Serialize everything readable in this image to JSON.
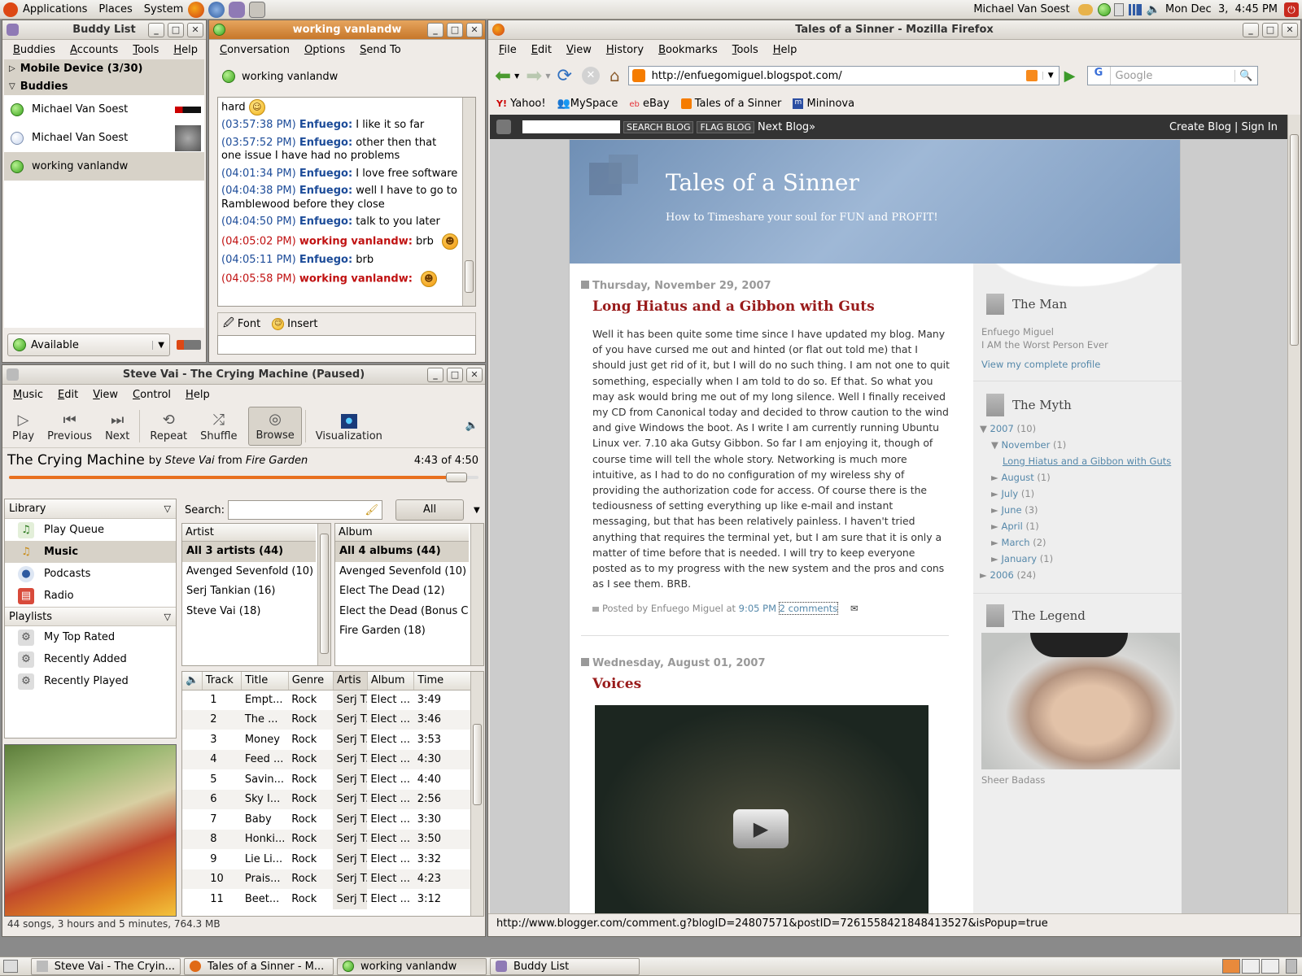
{
  "top_panel": {
    "menus": [
      "Applications",
      "Places",
      "System"
    ],
    "user": "Michael Van Soest",
    "clock": "Mon Dec  3,  4:45 PM"
  },
  "buddy_list": {
    "title": "Buddy List",
    "menu": [
      "Buddies",
      "Accounts",
      "Tools",
      "Help"
    ],
    "groups": [
      {
        "label": "Mobile Device (3/30)"
      },
      {
        "label": "Buddies"
      }
    ],
    "buddies": [
      {
        "name": "Michael Van Soest"
      },
      {
        "name": "Michael Van Soest"
      },
      {
        "name": "working vanlandw"
      }
    ],
    "status": "Available"
  },
  "conversation": {
    "title": "working vanlandw",
    "menu": [
      "Conversation",
      "Options",
      "Send To"
    ],
    "header_name": "working vanlandw",
    "first_line": "hard",
    "messages": [
      {
        "time": "(03:57:38 PM)",
        "who": "Enfuego:",
        "text": " I like it so far",
        "mine": false
      },
      {
        "time": "(03:57:52 PM)",
        "who": "Enfuego:",
        "text": " other then that one issue I have had no problems",
        "mine": false
      },
      {
        "time": "(04:01:34 PM)",
        "who": "Enfuego:",
        "text": " I love free software",
        "mine": false
      },
      {
        "time": "(04:04:38 PM)",
        "who": "Enfuego:",
        "text": " well I have to go to Ramblewood before they close",
        "mine": false
      },
      {
        "time": "(04:04:50 PM)",
        "who": "Enfuego:",
        "text": " talk to you later",
        "mine": false
      },
      {
        "time": "(04:05:02 PM)",
        "who": "working vanlandw:",
        "text": " brb",
        "mine": true
      },
      {
        "time": "(04:05:11 PM)",
        "who": "Enfuego:",
        "text": " brb",
        "mine": false
      },
      {
        "time": "(04:05:58 PM)",
        "who": "working vanlandw:",
        "text": "",
        "mine": true
      }
    ],
    "font_label": "Font",
    "insert_label": "Insert"
  },
  "rhythmbox": {
    "title": "Steve Vai - The Crying Machine (Paused)",
    "menu": [
      "Music",
      "Edit",
      "View",
      "Control",
      "Help"
    ],
    "toolbar": {
      "play": "Play",
      "previous": "Previous",
      "next": "Next",
      "repeat": "Repeat",
      "shuffle": "Shuffle",
      "browse": "Browse",
      "visualization": "Visualization"
    },
    "song": "The Crying Machine",
    "by": "by",
    "artist": "Steve Vai",
    "from": "from",
    "album": "Fire Garden",
    "time": "4:43 of 4:50",
    "progress": 0.976,
    "library_label": "Library",
    "library": [
      "Play Queue",
      "Music",
      "Podcasts",
      "Radio"
    ],
    "playlists_label": "Playlists",
    "playlists": [
      "My Top Rated",
      "Recently Added",
      "Recently Played"
    ],
    "search_label": "Search:",
    "all_button": "All",
    "artist_header": "Artist",
    "artists": [
      "All 3 artists (44)",
      "Avenged Sevenfold (10)",
      "Serj Tankian (16)",
      "Steve Vai (18)"
    ],
    "album_header": "Album",
    "albums": [
      "All 4 albums (44)",
      "Avenged Sevenfold (10)",
      "Elect The Dead (12)",
      "Elect the Dead (Bonus CD",
      "Fire Garden (18)"
    ],
    "track_headers": [
      "Track",
      "Title",
      "Genre",
      "Artis",
      "Album",
      "Time"
    ],
    "tracks": [
      [
        "1",
        "Empt...",
        "Rock",
        "Serj T...",
        "Elect ...",
        "3:49"
      ],
      [
        "2",
        "The ...",
        "Rock",
        "Serj T...",
        "Elect ...",
        "3:46"
      ],
      [
        "3",
        "Money",
        "Rock",
        "Serj T...",
        "Elect ...",
        "3:53"
      ],
      [
        "4",
        "Feed ...",
        "Rock",
        "Serj T...",
        "Elect ...",
        "4:30"
      ],
      [
        "5",
        "Savin...",
        "Rock",
        "Serj T...",
        "Elect ...",
        "4:40"
      ],
      [
        "6",
        "Sky I...",
        "Rock",
        "Serj T...",
        "Elect ...",
        "2:56"
      ],
      [
        "7",
        "Baby",
        "Rock",
        "Serj T...",
        "Elect ...",
        "3:30"
      ],
      [
        "8",
        "Honki...",
        "Rock",
        "Serj T...",
        "Elect ...",
        "3:50"
      ],
      [
        "9",
        "Lie Li...",
        "Rock",
        "Serj T...",
        "Elect ...",
        "3:32"
      ],
      [
        "10",
        "Prais...",
        "Rock",
        "Serj T...",
        "Elect ...",
        "4:23"
      ],
      [
        "11",
        "Beet...",
        "Rock",
        "Serj T...",
        "Elect ...",
        "3:12"
      ]
    ],
    "status": "44 songs, 3 hours and 5 minutes, 764.3 MB"
  },
  "firefox": {
    "title": "Tales of a Sinner - Mozilla Firefox",
    "menu": [
      "File",
      "Edit",
      "View",
      "History",
      "Bookmarks",
      "Tools",
      "Help"
    ],
    "url": "http://enfuegomiguel.blogspot.com/",
    "search_placeholder": "Google",
    "bookmarks": [
      "Yahoo!",
      "MySpace",
      "eBay",
      "Tales of a Sinner",
      "Mininova"
    ],
    "navbar": {
      "search_blog": "SEARCH BLOG",
      "flag_blog": "FLAG BLOG",
      "next_blog": "Next Blog»",
      "create": "Create Blog",
      "sep": "|",
      "signin": "Sign In"
    },
    "blog_title": "Tales of a Sinner",
    "blog_desc": "How to Timeshare your soul for FUN and PROFIT!",
    "post1": {
      "date": "Thursday, November 29, 2007",
      "title": "Long Hiatus and a Gibbon with Guts",
      "body": "Well it has been quite some time since I have updated my blog. Many of you have cursed me out and hinted (or flat out told me) that I should just get rid of it, but I will do no such thing. I am not one to quit something, especially when I am told to do so. Ef that. So what you may ask would bring me out of my long silence. Well I finally received my CD from Canonical today and decided to throw caution to the wind and give Windows the boot. As I write I am currently running Ubuntu Linux ver. 7.10 aka Gutsy Gibbon. So far I am enjoying it, though of course time will tell the whole story. Networking is much more intuitive, as I had to do no configuration of my wireless shy of providing the authorization code for access. Of course there is the tediousness of setting everything up like e-mail and instant messaging, but that has been relatively painless. I haven't tried anything that requires the terminal yet, but I am sure that it is only a matter of time before that is needed. I will try to keep everyone posted as to my progress with the new system and the pros and cons as I see them. BRB.",
      "posted_by": "Posted by Enfuego Miguel at",
      "time": "9:05 PM",
      "comments": "2 comments"
    },
    "post2": {
      "date": "Wednesday, August 01, 2007",
      "title": "Voices"
    },
    "sidebar": {
      "man_title": "The Man",
      "man_name": "Enfuego Miguel",
      "man_desc": "I AM the Worst Person Ever",
      "profile_link": "View my complete profile",
      "myth_title": "The Myth",
      "y2007": "2007",
      "y2007c": "(10)",
      "nov": "November",
      "novc": "(1)",
      "post_link": "Long Hiatus and a Gibbon with Guts",
      "months": [
        [
          "August",
          "(1)"
        ],
        [
          "July",
          "(1)"
        ],
        [
          "June",
          "(3)"
        ],
        [
          "April",
          "(1)"
        ],
        [
          "March",
          "(2)"
        ],
        [
          "January",
          "(1)"
        ]
      ],
      "y2006": "2006",
      "y2006c": "(24)",
      "legend_title": "The Legend",
      "caption": "Sheer Badass"
    },
    "status_url": "http://www.blogger.com/comment.g?blogID=24807571&postID=7261558421848413527&isPopup=true"
  },
  "taskbar": [
    "Steve Vai - The Cryin...",
    "Tales of a Sinner - M...",
    "working vanlandw",
    "Buddy List"
  ]
}
